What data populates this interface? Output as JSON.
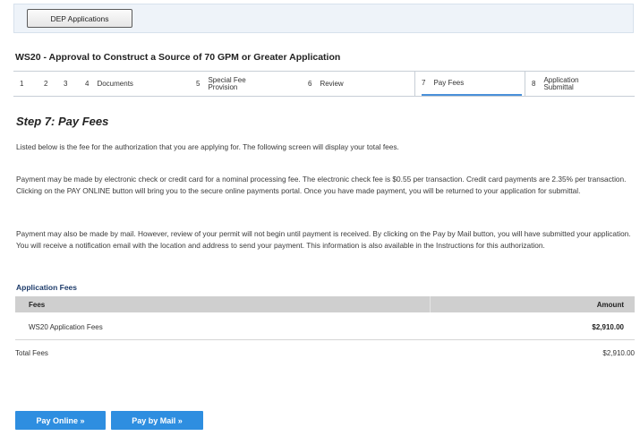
{
  "topbar": {
    "dep_button": "DEP Applications"
  },
  "application": {
    "title": "WS20 - Approval to Construct a Source of 70 GPM or Greater Application"
  },
  "steps": [
    {
      "num": "1",
      "label": ""
    },
    {
      "num": "2",
      "label": ""
    },
    {
      "num": "3",
      "label": ""
    },
    {
      "num": "4",
      "label": "Documents"
    },
    {
      "num": "5",
      "label": "Special Fee Provision"
    },
    {
      "num": "6",
      "label": "Review"
    },
    {
      "num": "7",
      "label": "Pay Fees"
    },
    {
      "num": "8",
      "label": "Application Submittal"
    }
  ],
  "page": {
    "heading": "Step 7: Pay Fees",
    "para1": "Listed below is the fee for the authorization that you are applying for. The following screen will display your total fees.",
    "para2": "Payment may be made by electronic check or credit card for a nominal processing fee. The electronic check fee is $0.55 per transaction. Credit card payments are 2.35% per transaction. Clicking on the PAY ONLINE button will bring you to the secure online payments portal. Once you have made payment, you will be returned to your application for submittal.",
    "para3": "Payment may also be made by mail. However, review of your permit will not begin until payment is received. By clicking on the Pay by Mail button, you will have submitted your application. You will receive a notification email with the location and address to send your payment. This information is also available in the Instructions for this authorization."
  },
  "fees": {
    "heading": "Application Fees",
    "col_fees": "Fees",
    "col_amount": "Amount",
    "rows": [
      {
        "name": "WS20 Application Fees",
        "amount": "$2,910.00"
      }
    ],
    "total_label": "Total Fees",
    "total_amount": "$2,910.00"
  },
  "buttons": {
    "pay_online": "Pay Online »",
    "pay_mail": "Pay by Mail »"
  },
  "colors": {
    "accent": "#2e8ee0",
    "heading_blue": "#1d3b6a",
    "table_header": "#cfcfcf"
  }
}
